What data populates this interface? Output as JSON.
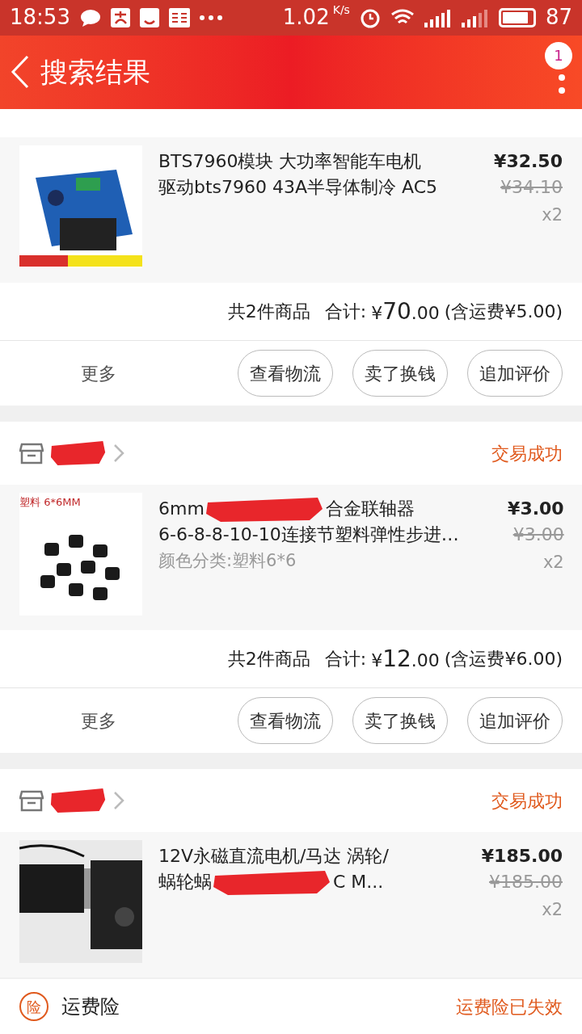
{
  "status_bar": {
    "time": "18:53",
    "speed": "1.02",
    "speed_unit": "K/s",
    "battery": "87"
  },
  "header": {
    "title": "搜索结果",
    "badge": "1"
  },
  "orders": [
    {
      "items": [
        {
          "kind": "board",
          "lines": [
            [
              {
                "kind": "text",
                "text": "BTS7960模块 大功率智能车电机"
              }
            ],
            [
              {
                "kind": "text",
                "text": "驱动bts7960 43A半导体制冷 AC5"
              }
            ]
          ],
          "price": "¥32.50",
          "original_price": "¥34.10",
          "quantity": "x2"
        }
      ],
      "summary": {
        "count": "共2件商品",
        "total_label": "合计:",
        "currency": "¥",
        "total_int": "70",
        "total_dec": ".00",
        "shipping": "(含运费¥5.00)"
      },
      "more": "更多",
      "actions": [
        "查看物流",
        "卖了换钱",
        "追加评价"
      ]
    },
    {
      "store": {
        "redacted": true
      },
      "status": "交易成功",
      "items": [
        {
          "kind": "parts",
          "image_caption": "塑料 6*6MM",
          "lines": [
            [
              {
                "kind": "text",
                "text": "6mm"
              },
              {
                "kind": "redaction"
              },
              {
                "kind": "text",
                "text": "合金联轴器"
              }
            ],
            [
              {
                "kind": "text",
                "text": "6-6-8-8-10-10连接节塑料弹性步进…"
              }
            ]
          ],
          "variant": "颜色分类:塑料6*6",
          "price": "¥3.00",
          "original_price": "¥3.00",
          "quantity": "x2"
        }
      ],
      "summary": {
        "count": "共2件商品",
        "total_label": "合计:",
        "currency": "¥",
        "total_int": "12",
        "total_dec": ".00",
        "shipping": "(含运费¥6.00)"
      },
      "more": "更多",
      "actions": [
        "查看物流",
        "卖了换钱",
        "追加评价"
      ]
    },
    {
      "store": {
        "redacted": true
      },
      "status": "交易成功",
      "items": [
        {
          "kind": "motor",
          "lines": [
            [
              {
                "kind": "text",
                "text": "12V永磁直流电机/马达 涡轮/"
              }
            ],
            [
              {
                "kind": "text",
                "text": "蜗轮蜗"
              },
              {
                "kind": "redaction"
              },
              {
                "kind": "text",
                "text": "C M..."
              }
            ]
          ],
          "price": "¥185.00",
          "original_price": "¥185.00",
          "quantity": "x2"
        }
      ]
    }
  ],
  "insurance": {
    "badge": "险",
    "title": "运费险",
    "status": "运费险已失效"
  }
}
